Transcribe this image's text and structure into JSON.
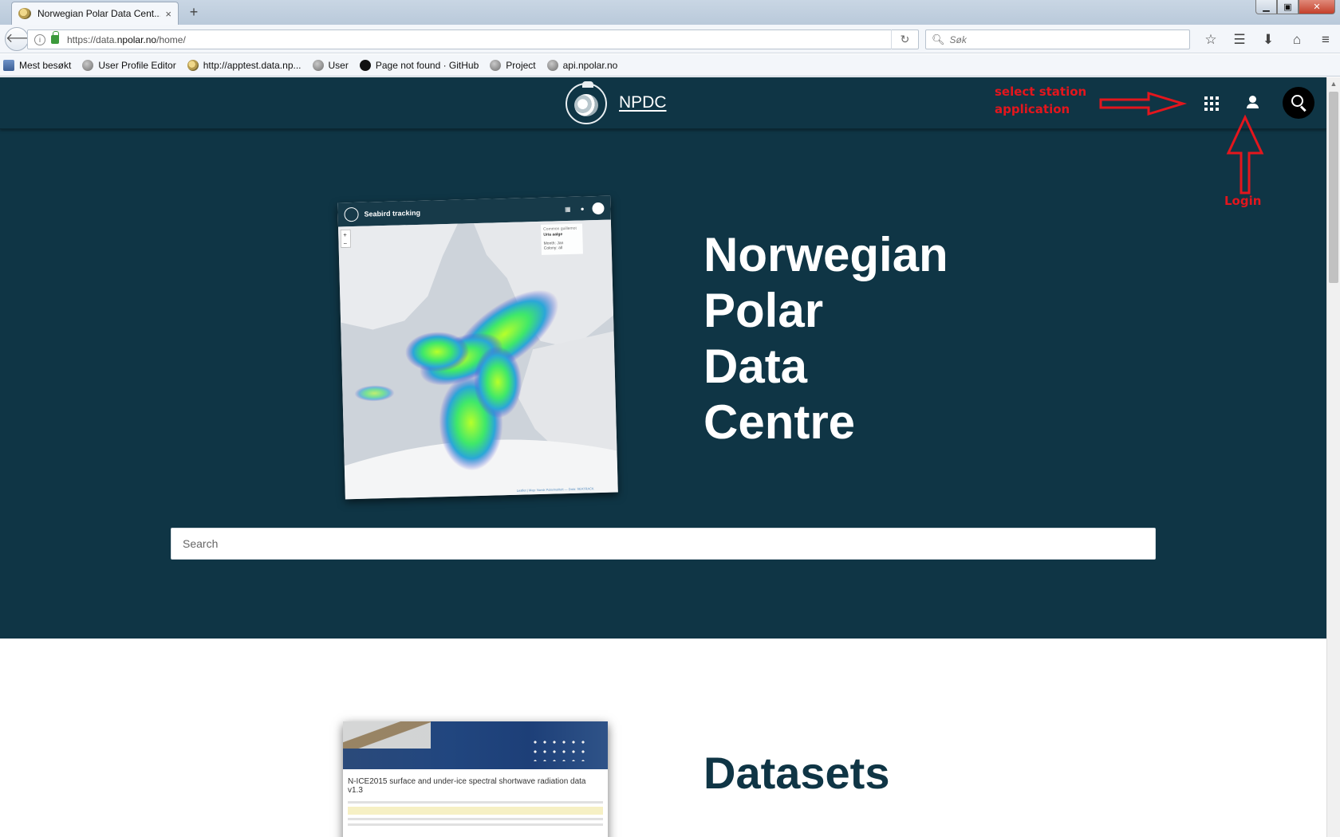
{
  "browser": {
    "tab_title": "Norwegian Polar Data Cent...",
    "tab_close": "×",
    "new_tab": "+",
    "window_controls": {
      "minimize": "▁",
      "maximize": "▣",
      "close": "✕"
    },
    "url_prefix": "https://data.",
    "url_domain": "npolar.no",
    "url_path": "/home/",
    "search_placeholder": "Søk",
    "toolbar_icons": [
      "star-icon",
      "reading-list-icon",
      "download-icon",
      "home-icon",
      "menu-icon"
    ],
    "bookmarks": [
      {
        "label": "Mest besøkt",
        "icon": "book-icon"
      },
      {
        "label": "User Profile Editor",
        "icon": "globe-icon"
      },
      {
        "label": "http://apptest.data.np...",
        "icon": "npolar-icon"
      },
      {
        "label": "User",
        "icon": "globe-icon"
      },
      {
        "label": "Page not found · GitHub",
        "icon": "github-icon"
      },
      {
        "label": "Project",
        "icon": "globe-icon"
      },
      {
        "label": "api.npolar.no",
        "icon": "globe-icon"
      }
    ]
  },
  "site": {
    "name": "NPDC",
    "hero_title_lines": [
      "Norwegian",
      "Polar",
      "Data",
      "Centre"
    ],
    "search_placeholder": "Search",
    "datasets_heading": "Datasets",
    "accent_color": "#0f3545"
  },
  "annotations": {
    "select_line1": "select station",
    "select_line2": "application",
    "login": "Login",
    "color": "#e3161d"
  },
  "preview_card": {
    "title": "Seabird tracking",
    "legend_title": "Common guillemot",
    "legend_species": "Uria aalge",
    "legend_month": "Month: Jan",
    "legend_colony": "Colony: all",
    "attribution": "Leaflet | Map: Norsk Polarinstitutt — Data: SEATRACK"
  },
  "dataset_card": {
    "title": "N-ICE2015 surface and under-ice spectral shortwave radiation data v1.3"
  }
}
